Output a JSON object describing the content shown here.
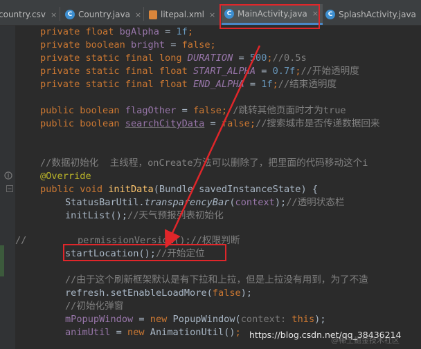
{
  "tabs": [
    {
      "label": "country.csv",
      "icon": "csv-file-icon",
      "active": false
    },
    {
      "label": "Country.java",
      "icon": "java-class-icon",
      "active": false
    },
    {
      "label": "litepal.xml",
      "icon": "xml-file-icon",
      "active": false
    },
    {
      "label": "MainActivity.java",
      "icon": "java-class-icon",
      "active": true
    },
    {
      "label": "SplashActivity.java",
      "icon": "java-class-icon",
      "active": false
    }
  ],
  "close_glyph": "×",
  "class_icon_glyph": "C",
  "code": {
    "l1": {
      "kw": "private float",
      "name": "bgAlpha",
      "rest": " = ",
      "val": "1f",
      "end": ";"
    },
    "l2": {
      "kw": "private boolean",
      "name": "bright",
      "rest": " = ",
      "val": "false",
      "end": ";"
    },
    "l3": {
      "kw": "private static final long",
      "name": "DURATION",
      "rest": " = ",
      "val": "500",
      "end": ";",
      "comment": "//0.5s"
    },
    "l4": {
      "kw": "private static final float",
      "name": "START_ALPHA",
      "rest": " = ",
      "val": "0.7f",
      "end": ";",
      "comment": "//开始透明度"
    },
    "l5": {
      "kw": "private static final float",
      "name": "END_ALPHA",
      "rest": " = ",
      "val": "1f",
      "end": ";",
      "comment": "//结束透明度"
    },
    "l6": {
      "kw": "public boolean",
      "name": "flagOther",
      "rest": " = ",
      "val": "false",
      "end": ";",
      "comment": "//跳转其他页面时才为true"
    },
    "l7": {
      "kw": "public boolean",
      "name": "searchCityData",
      "rest": " = ",
      "val": "false",
      "end": ";",
      "comment": "//搜索城市是否传递数据回来"
    },
    "l8": {
      "comment": "//数据初始化  主线程，onCreate方法可以删除了，把里面的代码移动这个i"
    },
    "l9": {
      "annotation": "@Override"
    },
    "l10": {
      "kw": "public void",
      "fn": "initData",
      "params": "(Bundle savedInstanceState) {"
    },
    "l11": {
      "cls": "StatusBarUtil.",
      "method": "transparencyBar",
      "args": "(",
      "arg_field": "context",
      "end": ");",
      "comment": "//透明状态栏"
    },
    "l12": {
      "call": "initList();",
      "comment": "//天气预报列表初始化"
    },
    "l13": {
      "marker": "//",
      "comment": "permissionVersion();//权限判断"
    },
    "l14": {
      "call": "startLocation();",
      "comment": "//开始定位"
    },
    "l15": {
      "comment": "//由于这个刷新框架默认是有下拉和上拉，但是上拉没有用到，为了不造"
    },
    "l16": {
      "call": "refresh.setEnableLoadMore(",
      "val": "false",
      "end": ");"
    },
    "l17": {
      "comment": "//初始化弹窗"
    },
    "l18": {
      "field": "mPopupWindow",
      "rest": " = ",
      "kw": "new",
      "ctor": " PopupWindow(",
      "hint": "context:",
      "this": " this",
      "end": ");"
    },
    "l19": {
      "field": "animUtil",
      "rest": " = ",
      "kw": "new",
      "ctor": " AnimationUtil()",
      "end": ";"
    }
  },
  "watermark": "https://blog.csdn.net/qq_38436214",
  "watermark_faint": "@稀土掘金技术社区",
  "colors": {
    "highlight": "#e0262a",
    "background": "#2b2b2b",
    "keyword": "#cc7832",
    "comment": "#808080",
    "field": "#9876aa"
  }
}
